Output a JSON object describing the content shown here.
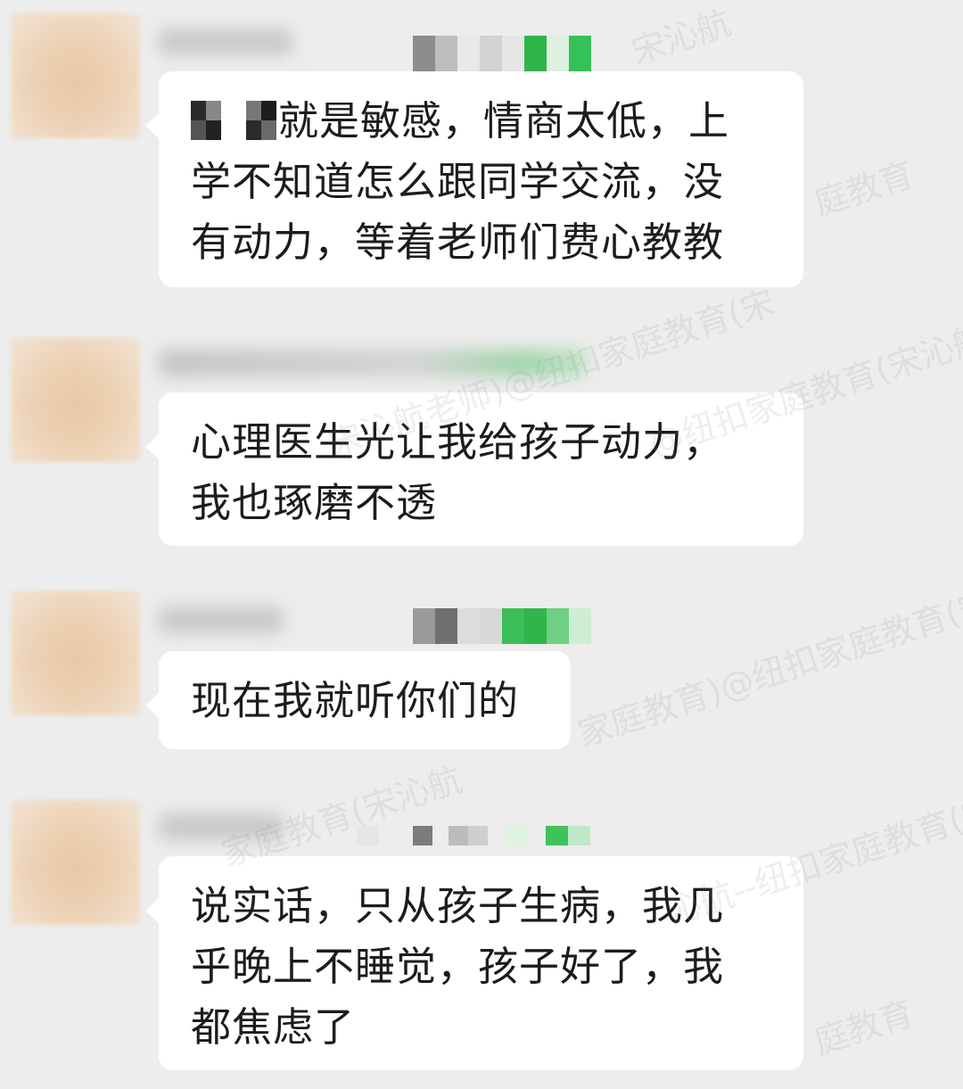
{
  "chat": {
    "messages": [
      {
        "sender_name_redacted": true,
        "avatar_redacted": true,
        "prefix_redacted": true,
        "text": "就是敏感，情商太低，上\n学不知道怎么跟同学交流，没\n有动力，等着老师们费心教教"
      },
      {
        "sender_name_redacted": true,
        "avatar_redacted": true,
        "text": "心理医生光让我给孩子动力，\n我也琢磨不透"
      },
      {
        "sender_name_redacted": true,
        "avatar_redacted": true,
        "text": "现在我就听你们的"
      },
      {
        "sender_name_redacted": true,
        "avatar_redacted": true,
        "text": "说实话，只从孩子生病，我几\n乎晚上不睡觉，孩子好了，我\n都焦虑了"
      }
    ]
  },
  "watermark": {
    "texts": [
      "@纽扣家庭教育(宋沁航老师",
      "纽扣家庭教育(宋沁航老师",
      "宋沁航老师)@纽扣家庭教育(宋",
      "家庭教育)@纽扣家庭教育(宋",
      "家庭教育(宋沁航",
      "沁航--纽扣家庭教育(宋",
      "庭教育",
      "宋沁航"
    ]
  },
  "colors": {
    "background": "#ededed",
    "bubble": "#ffffff",
    "text": "#1c1c1c",
    "redaction_green": "#2fbf4a",
    "redaction_gray": "#8a8a8a"
  }
}
